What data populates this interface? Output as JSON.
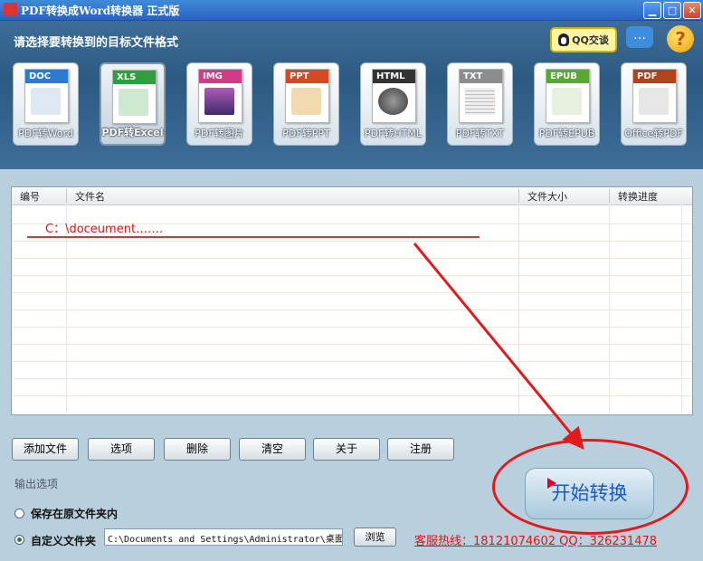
{
  "window": {
    "title": "PDF转换成Word转换器 正式版",
    "min": "▁",
    "max": "□",
    "close": "✕"
  },
  "header": {
    "prompt": "请选择要转换到的目标文件格式",
    "qq_label": "QQ交谈",
    "chat_glyph": "…",
    "help_glyph": "?"
  },
  "formats": [
    {
      "tag": "DOC",
      "label": "PDF转Word",
      "color": "#2a7bd1",
      "art": "#dde8f3"
    },
    {
      "tag": "XLS",
      "label": "PDF转Excel",
      "color": "#2f9e3e",
      "art": "#cfe9d0"
    },
    {
      "tag": "IMG",
      "label": "PDF转图片",
      "color": "#d33b87",
      "art": "#7f4c9a"
    },
    {
      "tag": "PPT",
      "label": "PDF转PPT",
      "color": "#d34a25",
      "art": "#f1d9b0"
    },
    {
      "tag": "HTML",
      "label": "PDF转HTML",
      "color": "#333333",
      "art": "#6a6a6a"
    },
    {
      "tag": "TXT",
      "label": "PDF转TXT",
      "color": "#8c8c8c",
      "art": "#eeeeee"
    },
    {
      "tag": "EPUB",
      "label": "PDF转EPUB",
      "color": "#5aa832",
      "art": "#e6f0dc"
    },
    {
      "tag": "PDF",
      "label": "Office转PDF",
      "color": "#b0431e",
      "art": "#e6e6e6"
    }
  ],
  "table": {
    "columns": [
      "编号",
      "文件名",
      "文件大小",
      "转换进度"
    ],
    "annotation": "C：\\doceument……."
  },
  "buttons": [
    "添加文件",
    "选项",
    "删除",
    "清空",
    "关于",
    "注册"
  ],
  "output": {
    "section_label": "输出选项",
    "radio_original": "保存在原文件夹内",
    "radio_custom": "自定义文件夹",
    "path_value": "C:\\Documents and Settings\\Administrator\\桌面",
    "browse_label": "浏览",
    "hotline": "客服热线：18121074602 QQ：326231478",
    "start_label": "开始转换"
  },
  "colors": {
    "annotation_red": "#e01414",
    "accent_blue": "#1a58c8"
  }
}
